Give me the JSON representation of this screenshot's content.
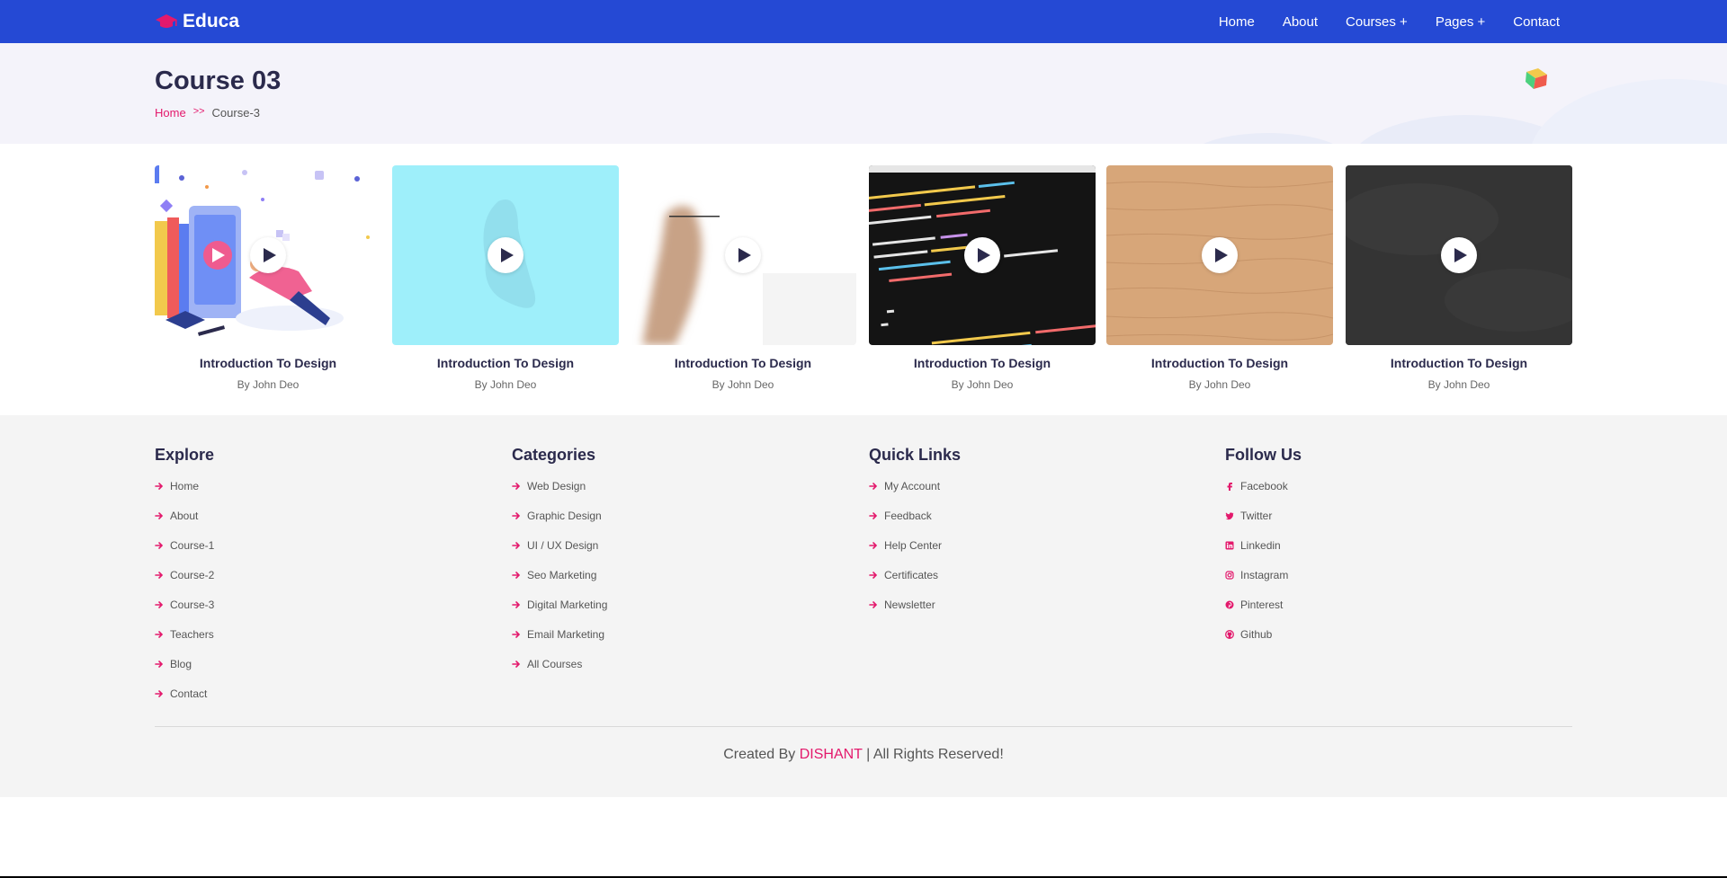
{
  "brand": {
    "name": "Educa"
  },
  "nav": {
    "items": [
      {
        "label": "Home"
      },
      {
        "label": "About"
      },
      {
        "label": "Courses +"
      },
      {
        "label": "Pages +"
      },
      {
        "label": "Contact"
      }
    ]
  },
  "header": {
    "title": "Course 03",
    "breadcrumb": {
      "home": "Home",
      "separator": ">>",
      "current": "Course-3"
    }
  },
  "courses": [
    {
      "title": "Introduction To Design",
      "author": "By John Deo",
      "thumb": "illustration"
    },
    {
      "title": "Introduction To Design",
      "author": "By John Deo",
      "thumb": "cyan-blob"
    },
    {
      "title": "Introduction To Design",
      "author": "By John Deo",
      "thumb": "hand"
    },
    {
      "title": "Introduction To Design",
      "author": "By John Deo",
      "thumb": "code"
    },
    {
      "title": "Introduction To Design",
      "author": "By John Deo",
      "thumb": "wood"
    },
    {
      "title": "Introduction To Design",
      "author": "By John Deo",
      "thumb": "chalkboard"
    }
  ],
  "footer": {
    "explore": {
      "heading": "Explore",
      "items": [
        "Home",
        "About",
        "Course-1",
        "Course-2",
        "Course-3",
        "Teachers",
        "Blog",
        "Contact"
      ]
    },
    "categories": {
      "heading": "Categories",
      "items": [
        "Web Design",
        "Graphic Design",
        "UI / UX Design",
        "Seo Marketing",
        "Digital Marketing",
        "Email Marketing",
        "All Courses"
      ]
    },
    "quick_links": {
      "heading": "Quick Links",
      "items": [
        "My Account",
        "Feedback",
        "Help Center",
        "Certificates",
        "Newsletter"
      ]
    },
    "follow": {
      "heading": "Follow Us",
      "items": [
        {
          "label": "Facebook",
          "icon": "facebook-icon"
        },
        {
          "label": "Twitter",
          "icon": "twitter-icon"
        },
        {
          "label": "Linkedin",
          "icon": "linkedin-icon"
        },
        {
          "label": "Instagram",
          "icon": "instagram-icon"
        },
        {
          "label": "Pinterest",
          "icon": "pinterest-icon"
        },
        {
          "label": "Github",
          "icon": "github-icon"
        }
      ]
    },
    "copyright": {
      "prefix": "Created By",
      "author": "DISHANT",
      "suffix": "| All Rights Reserved!"
    }
  },
  "colors": {
    "nav_bg": "#2549d4",
    "accent": "#e3196c",
    "heading": "#2b2a4c",
    "footer_bg": "#f4f4f4",
    "header_bg": "#f4f3fa"
  }
}
